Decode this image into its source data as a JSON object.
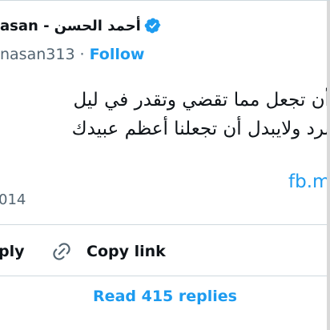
{
  "author": {
    "display_name": "أحمد الحسن",
    "name_suffix": "asan -",
    "handle": "nasan313",
    "separator": "·",
    "follow_label": "Follow"
  },
  "tweet": {
    "lines": [
      "أن تجعل مما تقضي وتقدر في ليل",
      "برد ولايبدل أن تجعلنا أعظم عبيدك"
    ],
    "link_text": "fb.m",
    "timestamp": "014"
  },
  "actions": {
    "reply_label": "ply",
    "copy_link_label": "Copy link"
  },
  "footer": {
    "read_replies_label": "Read 415 replies"
  },
  "colors": {
    "accent": "#1d9bf0",
    "text": "#0f1419",
    "muted": "#536471",
    "divider": "#cfd9de"
  },
  "icons": {
    "verified": "verified-badge-icon",
    "copy_link": "link-icon"
  }
}
